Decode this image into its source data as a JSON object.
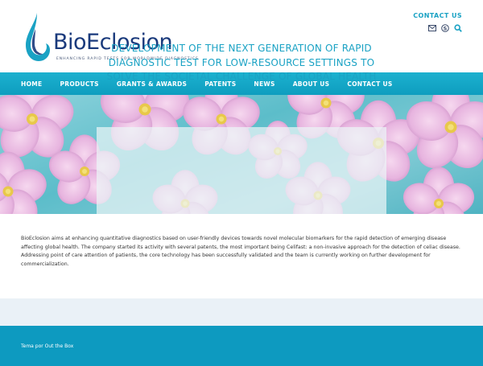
{
  "colors": {
    "accent": "#1aa2c4",
    "nav_bg": "#13a8c8",
    "logo": "#1a3a7c",
    "footer": "#0d9ac0"
  },
  "header": {
    "logo_text": "BioEclosion",
    "logo_tagline": "ENHANCING RAPID TESTS FOR WORLDWIDE DIAGNOSTICS",
    "contact_link": "CONTACT US",
    "icons": [
      "email-icon",
      "skype-icon",
      "search-icon"
    ]
  },
  "nav": {
    "items": [
      {
        "label": "HOME"
      },
      {
        "label": "PRODUCTS"
      },
      {
        "label": "GRANTS & AWARDS"
      },
      {
        "label": "PATENTS"
      },
      {
        "label": "NEWS"
      },
      {
        "label": "ABOUT US"
      },
      {
        "label": "CONTACT US"
      }
    ]
  },
  "hero": {
    "title": "DEVELOPMENT OF THE NEXT GENERATION OF RAPID DIAGNOSTIC TEST FOR LOW-RESOURCE SETTINGS TO SOLVE THE SOCIETAL CHALLENGE OF GLOBAL HEALTH"
  },
  "main": {
    "intro": "BioEclosion aims at enhancing quantitative diagnostics based on user-friendly devices towards novel molecular biomarkers for the rapid detection of emerging disease affecting global health. The company started its activity with several patents, the most important being Celifast: a non-invasive approach for the detection of celiac disease. Addressing point of care attention of patients, the core technology has been successfully validated and the team is currently working on further development for commercialization."
  },
  "footer": {
    "credit": "Tema por Out the Box"
  }
}
